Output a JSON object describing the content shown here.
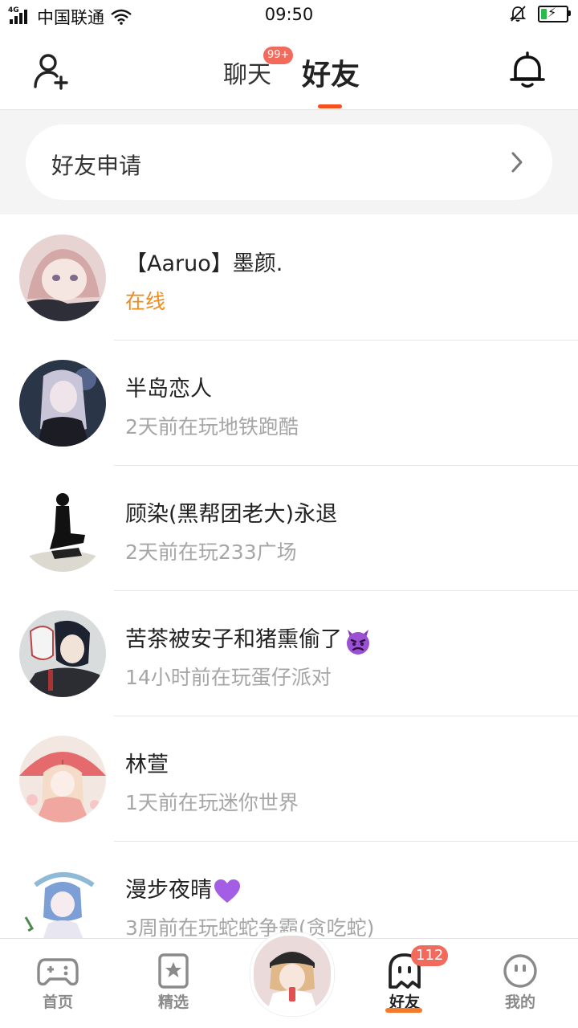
{
  "status_bar": {
    "network_type": "4G",
    "carrier": "中国联通",
    "time": "09:50",
    "icons": [
      "signal-icon",
      "wifi-icon",
      "bell-muted-icon",
      "battery-charging-icon"
    ],
    "battery_level": 0.22
  },
  "header": {
    "tabs": [
      {
        "label": "聊天",
        "badge": "99+",
        "active": false
      },
      {
        "label": "好友",
        "active": true
      }
    ],
    "left_icon": "add-friend-icon",
    "right_icon": "bell-icon",
    "accent_color": "#f4501e"
  },
  "friend_request": {
    "label": "好友申请",
    "icon": "chevron-right-icon"
  },
  "friends": [
    {
      "name": "【Aaruo】墨颜.",
      "status": "在线",
      "online": true,
      "avatar": "anime-girl-pink-hair-avatar"
    },
    {
      "name": "半岛恋人",
      "status": "2天前在玩地铁跑酷",
      "online": false,
      "avatar": "anime-girl-silver-hair-avatar"
    },
    {
      "name": "顾染(黑帮团老大)永退",
      "status": "2天前在玩233广场",
      "online": false,
      "avatar": "sitting-figure-sketch-avatar"
    },
    {
      "name": "苦茶被安子和猪熏偷了",
      "emoji": "angry-devil-emoji",
      "status": "14小时前在玩蛋仔派对",
      "online": false,
      "avatar": "anime-boy-fox-mask-avatar"
    },
    {
      "name": "林萱",
      "status": "1天前在玩迷你世界",
      "online": false,
      "avatar": "anime-girl-red-umbrella-avatar"
    },
    {
      "name": "漫步夜晴",
      "emoji": "purple-heart-emoji",
      "status": "3周前在玩蛇蛇争霸(贪吃蛇)",
      "online": false,
      "avatar": "anime-girl-blue-hair-avatar"
    }
  ],
  "bottom_nav": {
    "items": [
      {
        "label": "首页",
        "icon": "gamepad-icon",
        "active": false
      },
      {
        "label": "精选",
        "icon": "star-bookmark-icon",
        "active": false
      },
      {
        "label": "",
        "icon": "profile-avatar-center",
        "active": false
      },
      {
        "label": "好友",
        "icon": "ghost-friends-icon",
        "active": true,
        "badge": "112"
      },
      {
        "label": "我的",
        "icon": "smiley-face-icon",
        "active": false
      }
    ]
  },
  "colors": {
    "online_text": "#f08a1c",
    "secondary_text": "#a6a6a6",
    "badge": "#f26a5b"
  }
}
